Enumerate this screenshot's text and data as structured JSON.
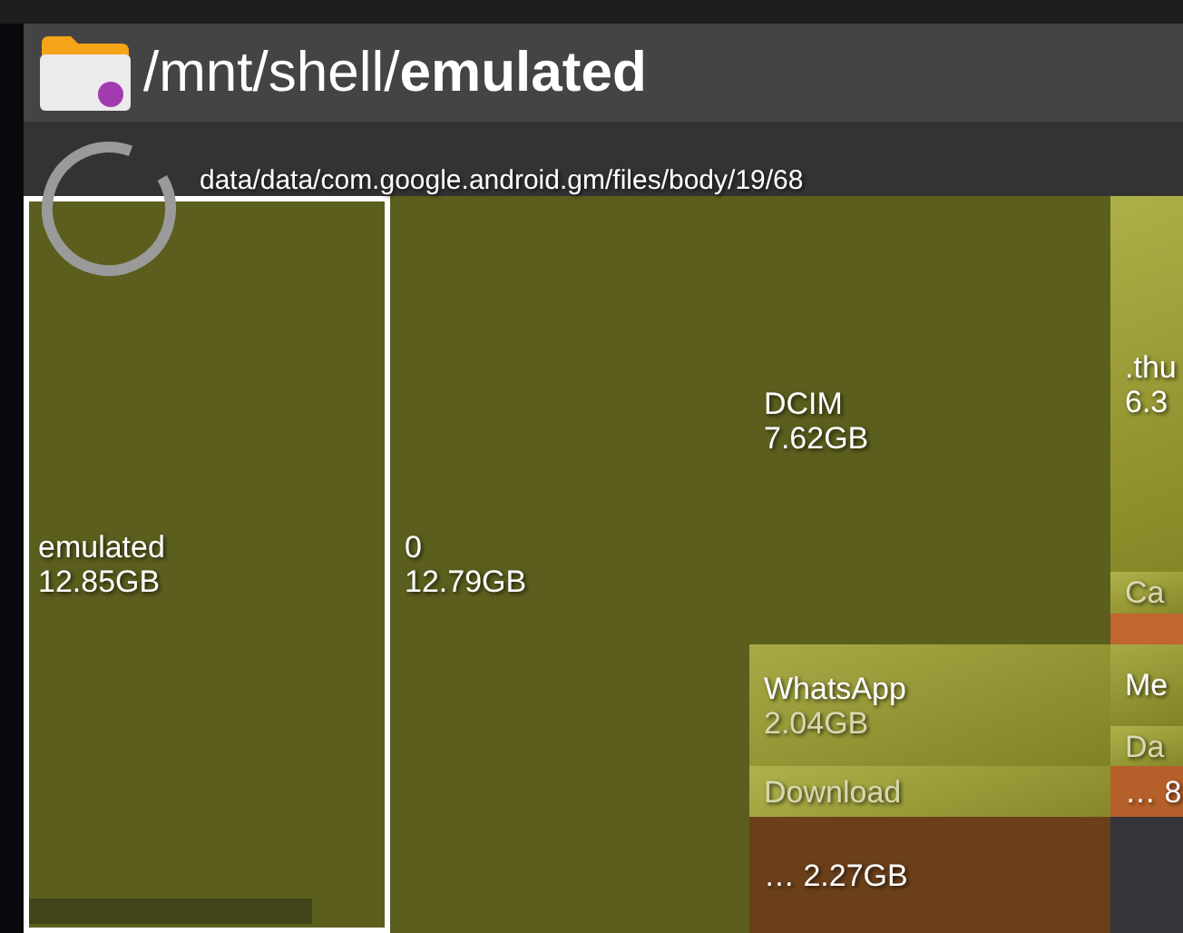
{
  "action_bar": {
    "title": "/mnt/shell/**emulated**"
  },
  "status": {
    "path": "data/data/com.google.android.gm/files/body/19/68"
  },
  "tiles": [
    {
      "label": "emulated",
      "size": "12.85GB",
      "kind": "flat",
      "color": "#5c5e1e",
      "selected": true,
      "children": [
        {
          "kind": "flat",
          "color": "#42441a",
          "selected": false
        }
      ]
    },
    {
      "label": "0",
      "size": "12.79GB",
      "kind": "flat",
      "color": "#5c5e1e",
      "selected": false,
      "children": [
        {
          "label": "DCIM",
          "size": "7.62GB",
          "kind": "flat",
          "color": "#5c5e1e",
          "selected": false
        },
        {
          "label": "WhatsApp",
          "size": "2.04GB",
          "kind": "glossy",
          "color": "#9c9e2c",
          "selected": false,
          "size_dimmed": true
        },
        {
          "label": "Download",
          "kind": "glossy",
          "color": "#a4a632",
          "selected": false,
          "dimmed": true
        },
        {
          "size": "… 2.27GB",
          "kind": "flat",
          "color": "#6b3f1a",
          "selected": false
        }
      ]
    },
    {
      "label": ".thu",
      "size": "6.3",
      "kind": "glossy",
      "color": "#a2a42e",
      "selected": false
    },
    {
      "label": "Ca",
      "kind": "glossy",
      "color": "#a4a632",
      "selected": false,
      "dimmed": true
    },
    {
      "kind": "flat",
      "color": "#c0662e",
      "selected": false
    },
    {
      "label": "Me",
      "kind": "glossy",
      "color": "#9c9e2c",
      "selected": false
    },
    {
      "label": "Da",
      "kind": "glossy",
      "color": "#a4a632",
      "selected": false,
      "dimmed": true
    },
    {
      "size": "… 8",
      "kind": "flat",
      "color": "#b5602a",
      "selected": false
    },
    {
      "kind": "flat",
      "color": "#33353a",
      "selected": false
    }
  ]
}
